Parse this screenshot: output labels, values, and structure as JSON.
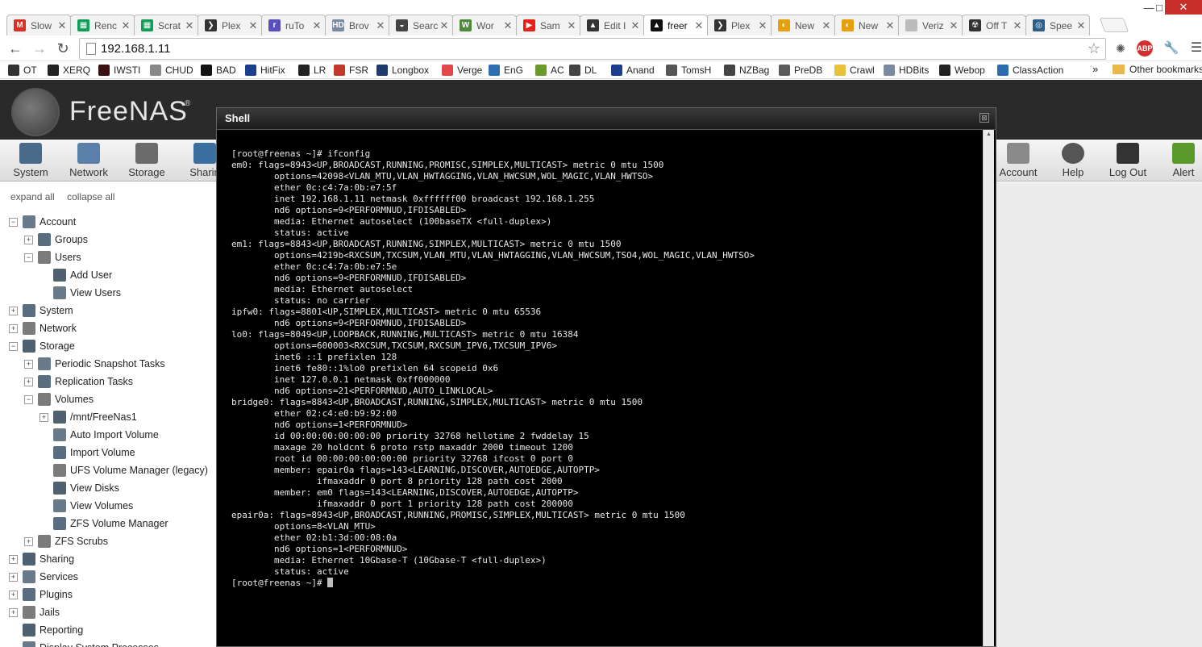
{
  "browser": {
    "tabs": [
      {
        "label": "Slow",
        "icon": "gmail-icon",
        "color": "#d93025",
        "glyph": "M",
        "active": false
      },
      {
        "label": "Renc",
        "icon": "sheets-icon",
        "color": "#0f9d58",
        "glyph": "▦",
        "active": false
      },
      {
        "label": "Scrat",
        "icon": "sheets-icon",
        "color": "#0f9d58",
        "glyph": "▦",
        "active": false
      },
      {
        "label": "Plex",
        "icon": "plex-icon",
        "color": "#333333",
        "glyph": "❯",
        "active": false
      },
      {
        "label": "ruTo",
        "icon": "rutorrent-icon",
        "color": "#5a4fbf",
        "glyph": "r",
        "active": false
      },
      {
        "label": "Brov",
        "icon": "hdbits-icon",
        "color": "#7a8aa0",
        "glyph": "HD",
        "active": false
      },
      {
        "label": "Searc",
        "icon": "nzbag-icon",
        "color": "#444444",
        "glyph": "◒",
        "active": false
      },
      {
        "label": "Wor",
        "icon": "word-icon",
        "color": "#4b8a3b",
        "glyph": "W",
        "active": false
      },
      {
        "label": "Sam",
        "icon": "youtube-icon",
        "color": "#e62117",
        "glyph": "▶",
        "active": false
      },
      {
        "label": "Edit I",
        "icon": "freenas-icon",
        "color": "#333333",
        "glyph": "▲",
        "active": false
      },
      {
        "label": "freer",
        "icon": "freenas-icon",
        "color": "#111111",
        "glyph": "▲",
        "active": true
      },
      {
        "label": "Plex",
        "icon": "plex-icon",
        "color": "#333333",
        "glyph": "❯",
        "active": false
      },
      {
        "label": "New",
        "icon": "plex-new-icon",
        "color": "#e5a00d",
        "glyph": "◐",
        "active": false
      },
      {
        "label": "New",
        "icon": "plex-new-icon",
        "color": "#e5a00d",
        "glyph": "◐",
        "active": false
      },
      {
        "label": "Veriz",
        "icon": "page-icon",
        "color": "#bbbbbb",
        "glyph": "",
        "active": false
      },
      {
        "label": "Off T",
        "icon": "ot-icon",
        "color": "#333333",
        "glyph": "☢",
        "active": false
      },
      {
        "label": "Spee",
        "icon": "speedtest-icon",
        "color": "#2b5f8a",
        "glyph": "◎",
        "active": false
      }
    ],
    "url": "192.168.1.11",
    "bookmarks": [
      {
        "label": "OT",
        "icon": "ot-icon",
        "color": "#333333"
      },
      {
        "label": "XERQ",
        "icon": "xerq-icon",
        "color": "#222222"
      },
      {
        "label": "IWSTI",
        "icon": "iwsti-icon",
        "color": "#3a1010"
      },
      {
        "label": "CHUD",
        "icon": "chud-icon",
        "color": "#888888"
      },
      {
        "label": "BAD",
        "icon": "bad-icon",
        "color": "#111111"
      },
      {
        "label": "HitFix",
        "icon": "hitfix-icon",
        "color": "#1a3e8c"
      },
      {
        "label": "LR",
        "icon": "lr-icon",
        "color": "#222222"
      },
      {
        "label": "FSR",
        "icon": "fsr-icon",
        "color": "#c0392b"
      },
      {
        "label": "Longbox",
        "icon": "longbox-icon",
        "color": "#1d3a6e"
      },
      {
        "label": "Verge",
        "icon": "verge-icon",
        "color": "#e2474b"
      },
      {
        "label": "EnG",
        "icon": "eng-icon",
        "color": "#2d6fb0"
      },
      {
        "label": "AC",
        "icon": "ac-icon",
        "color": "#6a9a2a"
      },
      {
        "label": "DL",
        "icon": "dl-icon",
        "color": "#444444"
      },
      {
        "label": "Anand",
        "icon": "anand-icon",
        "color": "#1a3e8c"
      },
      {
        "label": "TomsH",
        "icon": "tomsh-icon",
        "color": "#555555"
      },
      {
        "label": "NZBag",
        "icon": "nzbag-icon",
        "color": "#444444"
      },
      {
        "label": "PreDB",
        "icon": "predb-icon",
        "color": "#5a5a5a"
      },
      {
        "label": "Crawl",
        "icon": "crawl-icon",
        "color": "#e8c23a"
      },
      {
        "label": "HDBits",
        "icon": "hdbits-icon",
        "color": "#7a8aa0"
      },
      {
        "label": "Webop",
        "icon": "music-note-icon",
        "color": "#222222"
      },
      {
        "label": "ClassAction",
        "icon": "classaction-icon",
        "color": "#2b6cb0"
      }
    ],
    "more_label": "»",
    "other_bookmarks": "Other bookmarks",
    "win_min": "—",
    "win_max": "□",
    "win_close": "✕"
  },
  "freenas": {
    "title": "FreeNAS",
    "reg": "®",
    "nav_left": [
      {
        "label": "System",
        "icon": "system-icon"
      },
      {
        "label": "Network",
        "icon": "network-icon"
      },
      {
        "label": "Storage",
        "icon": "storage-icon"
      },
      {
        "label": "Sharin",
        "icon": "sharing-icon"
      }
    ],
    "nav_right": [
      {
        "label": "Account",
        "icon": "account-icon"
      },
      {
        "label": "Help",
        "icon": "help-icon"
      },
      {
        "label": "Log Out",
        "icon": "logout-icon"
      },
      {
        "label": "Alert",
        "icon": "alert-icon"
      }
    ],
    "expand_all": "expand all",
    "collapse_all": "collapse all",
    "tree": [
      {
        "label": "Account",
        "level": 0,
        "exp": "−"
      },
      {
        "label": "Groups",
        "level": 1,
        "exp": "+"
      },
      {
        "label": "Users",
        "level": 1,
        "exp": "−"
      },
      {
        "label": "Add User",
        "level": 2,
        "exp": ""
      },
      {
        "label": "View Users",
        "level": 2,
        "exp": ""
      },
      {
        "label": "System",
        "level": 0,
        "exp": "+"
      },
      {
        "label": "Network",
        "level": 0,
        "exp": "+"
      },
      {
        "label": "Storage",
        "level": 0,
        "exp": "−"
      },
      {
        "label": "Periodic Snapshot Tasks",
        "level": 1,
        "exp": "+"
      },
      {
        "label": "Replication Tasks",
        "level": 1,
        "exp": "+"
      },
      {
        "label": "Volumes",
        "level": 1,
        "exp": "−"
      },
      {
        "label": "/mnt/FreeNas1",
        "level": 2,
        "exp": "+"
      },
      {
        "label": "Auto Import Volume",
        "level": 2,
        "exp": ""
      },
      {
        "label": "Import Volume",
        "level": 2,
        "exp": ""
      },
      {
        "label": "UFS Volume Manager (legacy)",
        "level": 2,
        "exp": ""
      },
      {
        "label": "View Disks",
        "level": 2,
        "exp": ""
      },
      {
        "label": "View Volumes",
        "level": 2,
        "exp": ""
      },
      {
        "label": "ZFS Volume Manager",
        "level": 2,
        "exp": ""
      },
      {
        "label": "ZFS Scrubs",
        "level": 1,
        "exp": "+"
      },
      {
        "label": "Sharing",
        "level": 0,
        "exp": "+"
      },
      {
        "label": "Services",
        "level": 0,
        "exp": "+"
      },
      {
        "label": "Plugins",
        "level": 0,
        "exp": "+"
      },
      {
        "label": "Jails",
        "level": 0,
        "exp": "+"
      },
      {
        "label": "Reporting",
        "level": 0,
        "exp": ""
      },
      {
        "label": "Display System Processes",
        "level": 0,
        "exp": ""
      }
    ]
  },
  "shell": {
    "title": "Shell",
    "close": "⊠",
    "lines": [
      "[root@freenas ~]# ifconfig",
      "em0: flags=8943<UP,BROADCAST,RUNNING,PROMISC,SIMPLEX,MULTICAST> metric 0 mtu 1500",
      "        options=42098<VLAN_MTU,VLAN_HWTAGGING,VLAN_HWCSUM,WOL_MAGIC,VLAN_HWTSO>",
      "        ether 0c:c4:7a:0b:e7:5f",
      "        inet 192.168.1.11 netmask 0xffffff00 broadcast 192.168.1.255",
      "        nd6 options=9<PERFORMNUD,IFDISABLED>",
      "        media: Ethernet autoselect (100baseTX <full-duplex>)",
      "        status: active",
      "em1: flags=8843<UP,BROADCAST,RUNNING,SIMPLEX,MULTICAST> metric 0 mtu 1500",
      "        options=4219b<RXCSUM,TXCSUM,VLAN_MTU,VLAN_HWTAGGING,VLAN_HWCSUM,TSO4,WOL_MAGIC,VLAN_HWTSO>",
      "        ether 0c:c4:7a:0b:e7:5e",
      "        nd6 options=9<PERFORMNUD,IFDISABLED>",
      "        media: Ethernet autoselect",
      "        status: no carrier",
      "ipfw0: flags=8801<UP,SIMPLEX,MULTICAST> metric 0 mtu 65536",
      "        nd6 options=9<PERFORMNUD,IFDISABLED>",
      "lo0: flags=8049<UP,LOOPBACK,RUNNING,MULTICAST> metric 0 mtu 16384",
      "        options=600003<RXCSUM,TXCSUM,RXCSUM_IPV6,TXCSUM_IPV6>",
      "        inet6 ::1 prefixlen 128",
      "        inet6 fe80::1%lo0 prefixlen 64 scopeid 0x6",
      "        inet 127.0.0.1 netmask 0xff000000",
      "        nd6 options=21<PERFORMNUD,AUTO_LINKLOCAL>",
      "bridge0: flags=8843<UP,BROADCAST,RUNNING,SIMPLEX,MULTICAST> metric 0 mtu 1500",
      "        ether 02:c4:e0:b9:92:00",
      "        nd6 options=1<PERFORMNUD>",
      "        id 00:00:00:00:00:00 priority 32768 hellotime 2 fwddelay 15",
      "        maxage 20 holdcnt 6 proto rstp maxaddr 2000 timeout 1200",
      "        root id 00:00:00:00:00:00 priority 32768 ifcost 0 port 0",
      "        member: epair0a flags=143<LEARNING,DISCOVER,AUTOEDGE,AUTOPTP>",
      "                ifmaxaddr 0 port 8 priority 128 path cost 2000",
      "        member: em0 flags=143<LEARNING,DISCOVER,AUTOEDGE,AUTOPTP>",
      "                ifmaxaddr 0 port 1 priority 128 path cost 200000",
      "epair0a: flags=8943<UP,BROADCAST,RUNNING,PROMISC,SIMPLEX,MULTICAST> metric 0 mtu 1500",
      "        options=8<VLAN_MTU>",
      "        ether 02:b1:3d:00:08:0a",
      "        nd6 options=1<PERFORMNUD>",
      "        media: Ethernet 10Gbase-T (10Gbase-T <full-duplex>)",
      "        status: active"
    ],
    "prompt": "[root@freenas ~]# "
  },
  "colors": {
    "header_bg": "#2a2a2a",
    "terminal_bg": "#000000",
    "terminal_fg": "#e8e8e8"
  }
}
